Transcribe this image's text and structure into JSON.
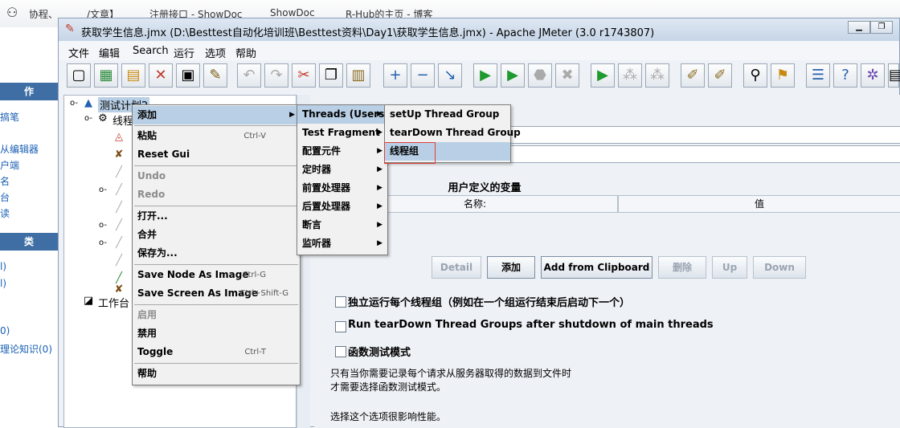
{
  "browser_tabs": [
    "协程、",
    "/文章】",
    "注册接口 - ShowDoc",
    "ShowDoc",
    "R-Hub的主页 - 博客"
  ],
  "left_sidebar": {
    "header_top": "作",
    "links_top": [
      "搞笔",
      "从编辑器",
      "户端",
      "名",
      "台",
      "读"
    ],
    "header_bottom": "类",
    "links_bottom": [
      "l)",
      "l)",
      "0)",
      "理论知识(0)"
    ]
  },
  "window": {
    "title": "获取学生信息.jmx (D:\\Besttest自动化培训班\\Besttest资料\\Day1\\获取学生信息.jmx) - Apache JMeter (3.0 r1743807)"
  },
  "menubar": [
    "文件",
    "编辑",
    "Search",
    "运行",
    "选项",
    "帮助"
  ],
  "tree": {
    "root": "测试计划2",
    "child": "线程",
    "workbench": "工作台"
  },
  "right_panel": {
    "variables_title": "用户定义的变量",
    "col_name": "名称:",
    "col_value": "值",
    "buttons": {
      "detail": "Detail",
      "add": "添加",
      "add_clipboard": "Add from Clipboard",
      "delete": "删除",
      "up": "Up",
      "down": "Down"
    },
    "check_1": "独立运行每个线程组（例如在一个组运行结束后启动下一个）",
    "check_2": "Run tearDown Thread Groups after shutdown of main threads",
    "check_3": "函数测试模式",
    "note_1": "只有当你需要记录每个请求从服务器取得的数据到文件时",
    "note_2": "才需要选择函数测试模式。",
    "note_3": "选择这个选项很影响性能。"
  },
  "context_menu": {
    "items": [
      {
        "label": "添加",
        "shortcut": "",
        "arrow": true
      },
      {
        "label": "粘贴",
        "shortcut": "Ctrl-V"
      },
      {
        "label": "Reset Gui",
        "shortcut": ""
      },
      {
        "label": "Undo",
        "shortcut": ""
      },
      {
        "label": "Redo",
        "shortcut": ""
      },
      {
        "label": "打开...",
        "shortcut": ""
      },
      {
        "label": "合并",
        "shortcut": ""
      },
      {
        "label": "保存为...",
        "shortcut": ""
      },
      {
        "label": "Save Node As Image",
        "shortcut": "Ctrl-G"
      },
      {
        "label": "Save Screen As Image",
        "shortcut": "Ctrl+Shift-G"
      },
      {
        "label": "启用",
        "shortcut": ""
      },
      {
        "label": "禁用",
        "shortcut": ""
      },
      {
        "label": "Toggle",
        "shortcut": "Ctrl-T"
      },
      {
        "label": "帮助",
        "shortcut": ""
      }
    ]
  },
  "submenu_add": {
    "items": [
      "Threads (Users)",
      "Test Fragment",
      "配置元件",
      "定时器",
      "前置处理器",
      "后置处理器",
      "断言",
      "监听器"
    ]
  },
  "submenu_threads": {
    "items": [
      "setUp Thread Group",
      "tearDown Thread Group",
      "线程组"
    ]
  },
  "colors": {
    "highlight": "#b8cfe5",
    "title_bar": "#c6d5e7",
    "annotation_red": "#e0403a"
  }
}
